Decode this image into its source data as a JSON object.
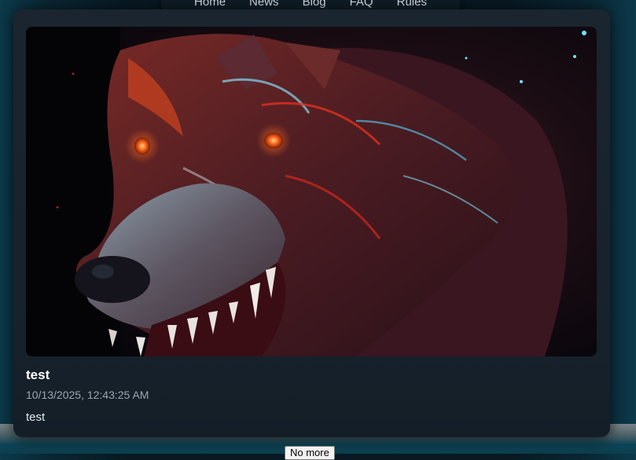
{
  "nav": {
    "items": [
      "Home",
      "News",
      "Blog",
      "FAQ",
      "Rules"
    ]
  },
  "post": {
    "title": "test",
    "date": "10/13/2025, 12:43:25 AM",
    "body": "test",
    "image_alt": "wolf-artwork"
  },
  "load_more": {
    "label": "No more"
  },
  "colors": {
    "card_bg": "#19232d",
    "page_bg": "#081923",
    "edge_glow": "#0b3a4a",
    "eye_glow": "#ff5a1a"
  }
}
